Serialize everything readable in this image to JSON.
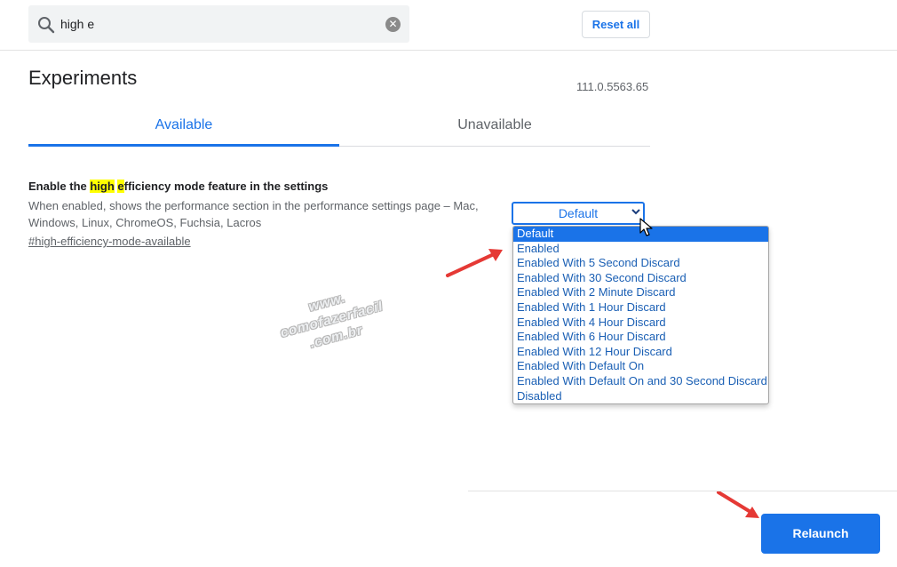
{
  "search": {
    "value": "high e",
    "icon": "search-icon",
    "clear_icon": "close-icon"
  },
  "header": {
    "reset_label": "Reset all"
  },
  "page": {
    "title": "Experiments",
    "version": "111.0.5563.65"
  },
  "tabs": [
    {
      "label": "Available",
      "active": true
    },
    {
      "label": "Unavailable",
      "active": false
    }
  ],
  "experiment": {
    "title_before": "Enable the ",
    "title_highlight_1": "high",
    "title_space": " ",
    "title_highlight_2": "e",
    "title_after": "fficiency mode feature in the settings",
    "description": "When enabled, shows the performance section in the performance settings page – Mac, Windows, Linux, ChromeOS, Fuchsia, Lacros",
    "link": "#high-efficiency-mode-available",
    "selected_value": "Default",
    "options": [
      "Default",
      "Enabled",
      "Enabled With 5 Second Discard",
      "Enabled With 30 Second Discard",
      "Enabled With 2 Minute Discard",
      "Enabled With 1 Hour Discard",
      "Enabled With 4 Hour Discard",
      "Enabled With 6 Hour Discard",
      "Enabled With 12 Hour Discard",
      "Enabled With Default On",
      "Enabled With Default On and 30 Second Discard",
      "Disabled"
    ]
  },
  "watermark": {
    "line1": "www.",
    "line2": "comofazerfacil",
    "line3": ".com.br"
  },
  "footer": {
    "relaunch_label": "Relaunch"
  },
  "colors": {
    "accent": "#1a73e8",
    "highlight": "#ffff00",
    "annotation_arrow": "#e53935"
  }
}
